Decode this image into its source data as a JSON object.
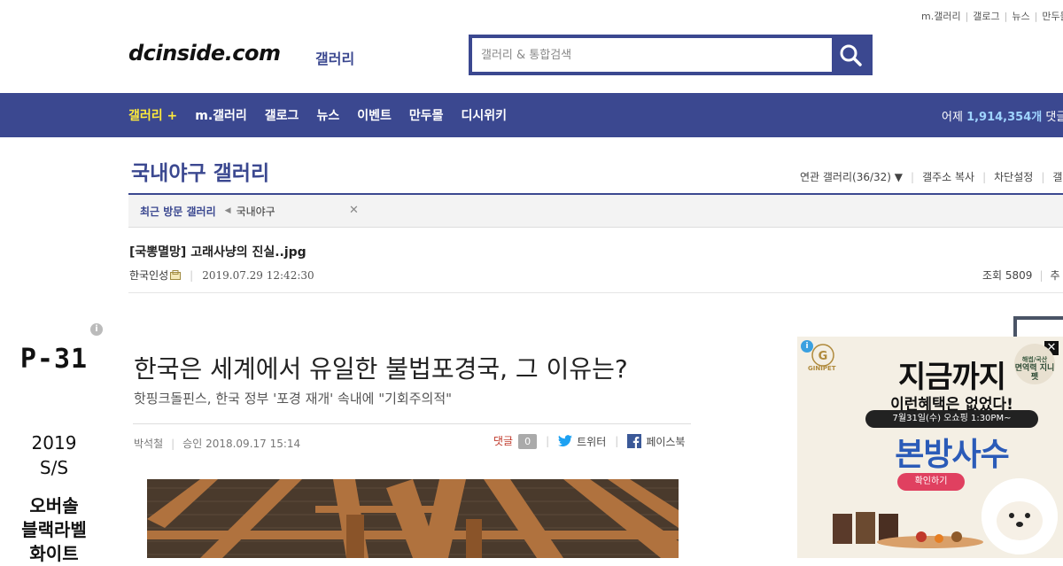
{
  "util_links": [
    "m.갤러리",
    "갤로그",
    "뉴스",
    "만두몰"
  ],
  "logo": {
    "text": "dcinside.com",
    "sub": "갤러리"
  },
  "search": {
    "placeholder": "갤러리 & 통합검색"
  },
  "nav": {
    "items": [
      "갤러리 +",
      "m.갤러리",
      "갤로그",
      "뉴스",
      "이벤트",
      "만두몰",
      "디시위키"
    ],
    "stats_prefix": "어제",
    "stats_value": "1,914,354개",
    "stats_suffix": "댓글"
  },
  "gallery": {
    "title": "국내야구 갤러리",
    "tools": [
      "연관 갤러리(36/32)",
      "갤주소 복사",
      "차단설정",
      "갤러"
    ]
  },
  "recent": {
    "label": "최근 방문 갤러리",
    "items": [
      "국내야구"
    ]
  },
  "post": {
    "title": "[국뽕멸망] 고래사냥의 진실..jpg",
    "author": "한국인성",
    "datetime": "2019.07.29 12:42:30",
    "views": "조회 5809",
    "views_more": "추"
  },
  "left_ad": {
    "line1": "P-31",
    "line2a": "2019",
    "line2b": "S/S",
    "line3a": "오버솔",
    "line3b": "블랙라벨",
    "line3c": "화이트"
  },
  "article": {
    "headline": "한국은 세계에서 유일한 불법포경국, 그 이유는?",
    "subhead": "핫핑크돌핀스, 한국 정부 '포경 재개' 속내에 \"기회주의적\"",
    "byline": "박석철",
    "approved": "승인 2018.09.17 15:14",
    "comment_label": "댓글",
    "comment_count": "0",
    "twitter": "트위터",
    "facebook": "페이스북"
  },
  "right_ad": {
    "brand": "GINIPET",
    "headline1": "지금까지",
    "headline2": "이런혜택은 없었다!",
    "date": "7월31일(수) 오쇼핑 1:30PM~",
    "headline3": "본방사수",
    "cta": "확인하기",
    "badge_top": "해썹/국산",
    "badge_main": "면역력 지니펫"
  },
  "colors": {
    "primary": "#3b4890",
    "nav_highlight": "#ffeb3b",
    "stats_value": "#9fd4ff",
    "comment": "#c0392b"
  }
}
